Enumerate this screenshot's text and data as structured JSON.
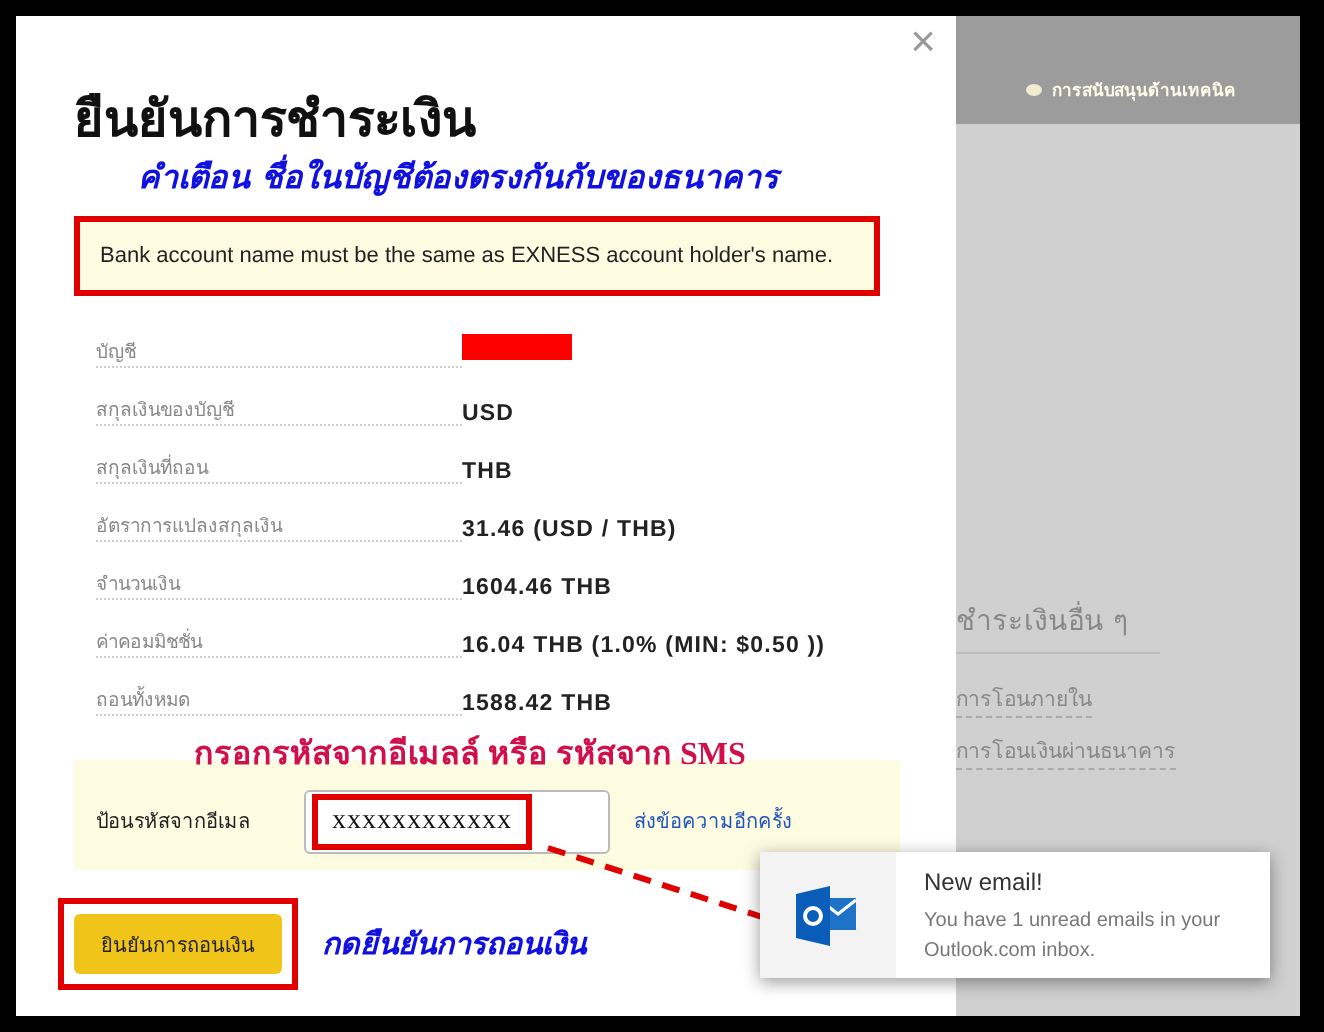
{
  "dialog": {
    "close": "×",
    "title": "ยืนยันการชำระเงิน",
    "warning_note": "คำเตือน  ชื่อในบัญชีต้องตรงกันกับของธนาคาร",
    "notice": "Bank account name must be the same as EXNESS account holder's name.",
    "details": [
      {
        "label": "บัญชี",
        "kind": "redacted"
      },
      {
        "label": "สกุลเงินของบัญชี",
        "kind": "text",
        "value": "USD"
      },
      {
        "label": "สกุลเงินที่ถอน",
        "kind": "text",
        "value": "THB"
      },
      {
        "label": "อัตราการแปลงสกุลเงิน",
        "kind": "text",
        "value": "31.46 (USD / THB)"
      },
      {
        "label": "จำนวนเงิน",
        "kind": "text",
        "value": "1604.46 THB"
      },
      {
        "label": "ค่าคอมมิชชั่น",
        "kind": "text",
        "value": "16.04 THB (1.0% (MIN: $0.50 ))"
      },
      {
        "label": "ถอนทั้งหมด",
        "kind": "text",
        "value": "1588.42 THB"
      }
    ],
    "code_note": "กรอกรหัสจากอีเมลล์ หรือ รหัสจาก SMS",
    "code_label": "ป้อนรหัสจากอีเมล",
    "code_value": "xxxxxxxxxxxx",
    "resend_link": "ส่งข้อความอีกครั้ง",
    "confirm_button": "ยินยันการถอนเงิน",
    "confirm_note": "กดยืนยันการถอนเงิน"
  },
  "background": {
    "support_link": "การสนับสนุนด้านเทคนิค",
    "section_heading": "ชำระเงินอื่น ๆ",
    "links": [
      "การโอนภายใน",
      "การโอนเงินผ่านธนาคาร"
    ]
  },
  "notification": {
    "title": "New email!",
    "message": "You have 1 unread emails in your Outlook.com inbox."
  }
}
